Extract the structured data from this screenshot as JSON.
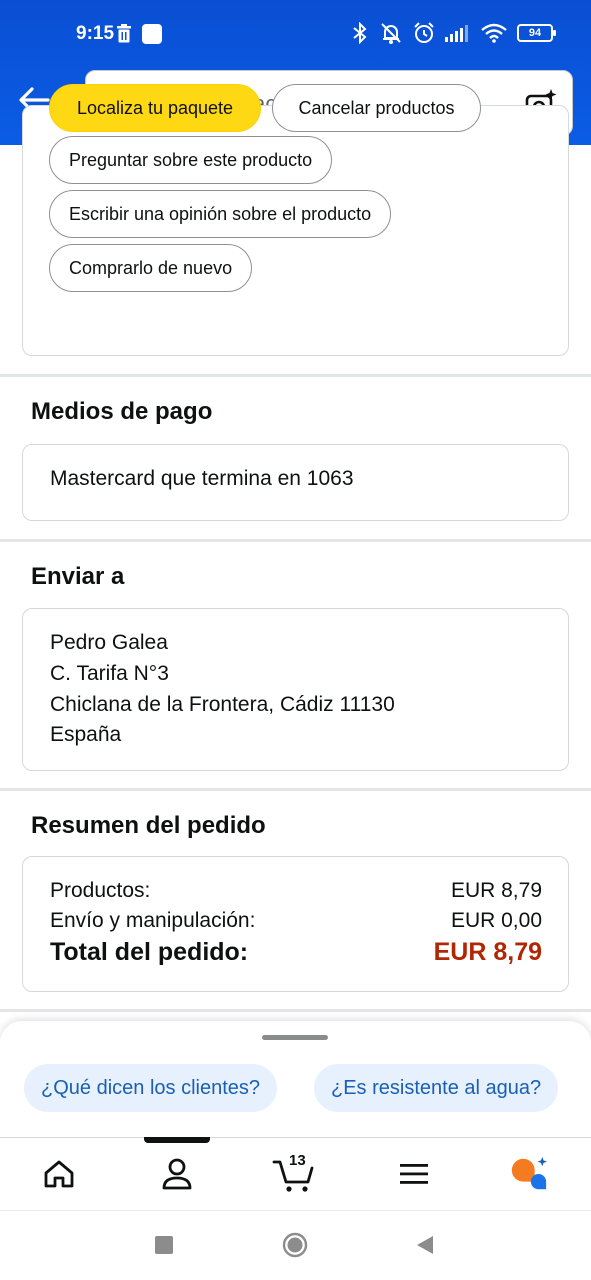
{
  "status_bar": {
    "time": "9:15",
    "battery": "94"
  },
  "header": {
    "search_placeholder": "Buscar o hacer una pregunta"
  },
  "actions": {
    "track_package": "Localiza tu paquete",
    "cancel_products": "Cancelar productos",
    "ask_product": "Preguntar sobre este producto",
    "write_review": "Escribir una opinión sobre el producto",
    "buy_again": "Comprarlo de nuevo"
  },
  "payment": {
    "title": "Medios de pago",
    "method": "Mastercard  que termina en 1063"
  },
  "shipping": {
    "title": "Enviar a",
    "name": "Pedro Galea",
    "street": "C. Tarifa N°3",
    "city": "Chiclana de la Frontera, Cádiz 11130",
    "country": "España"
  },
  "summary": {
    "title": "Resumen del pedido",
    "products_label": "Productos:",
    "products_value": "EUR 8,79",
    "shipping_label": "Envío y manipulación:",
    "shipping_value": "EUR 0,00",
    "total_label": "Total del pedido:",
    "total_value": "EUR 8,79"
  },
  "suggestions": {
    "chip1": "¿Qué dicen los clientes?",
    "chip2": "¿Es resistente al agua?"
  },
  "tabbar": {
    "cart_count": "13"
  },
  "colors": {
    "header_blue": "#0b52d6",
    "accent_yellow": "#ffd814",
    "price_red": "#b12704",
    "chip_bg": "#e7f1fd",
    "chip_text": "#1a5fb4"
  }
}
